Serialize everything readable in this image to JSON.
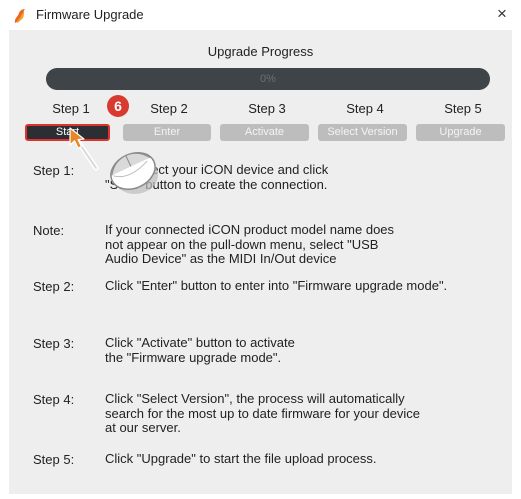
{
  "window": {
    "title": "Firmware Upgrade",
    "close_glyph": "×"
  },
  "progress": {
    "title": "Upgrade Progress",
    "value_text": "0%",
    "percent": 0
  },
  "steps": [
    {
      "label": "Step 1",
      "button": "Start"
    },
    {
      "label": "Step 2",
      "button": "Enter"
    },
    {
      "label": "Step 3",
      "button": "Activate"
    },
    {
      "label": "Step 4",
      "button": "Select Version"
    },
    {
      "label": "Step 5",
      "button": "Upgrade"
    }
  ],
  "callout_number": "6",
  "instructions": [
    {
      "key": "Step 1:",
      "lines": [
        "connect your iCON device and click",
        "\"Start\" button to create the connection."
      ]
    },
    {
      "key": "Note:",
      "lines": [
        "If your connected iCON product model name does",
        "not appear on the pull-down menu, select \"USB",
        "Audio Device\" as the MIDI In/Out device"
      ]
    },
    {
      "key": "Step 2:",
      "lines": [
        "Click \"Enter\" button to enter into \"Firmware upgrade mode\"."
      ]
    },
    {
      "key": "Step 3:",
      "lines": [
        "Click \"Activate\" button to activate",
        "the \"Firmware upgrade mode\"."
      ]
    },
    {
      "key": "Step 4:",
      "lines": [
        "Click \"Select Version\", the process will automatically",
        "search for the most up to date firmware for your device",
        "at our server."
      ]
    },
    {
      "key": "Step 5:",
      "lines": [
        "Click \"Upgrade\" to start the file upload process."
      ]
    }
  ],
  "icons": {
    "app": "flame-app-icon",
    "close": "close-icon",
    "cursor": "arrow-cursor-icon",
    "mouse": "mouse-click-icon"
  },
  "colors": {
    "active_outline": "#e0322c",
    "badge": "#d83a2f",
    "track": "#3f4449",
    "cursor": "#e8862a"
  }
}
